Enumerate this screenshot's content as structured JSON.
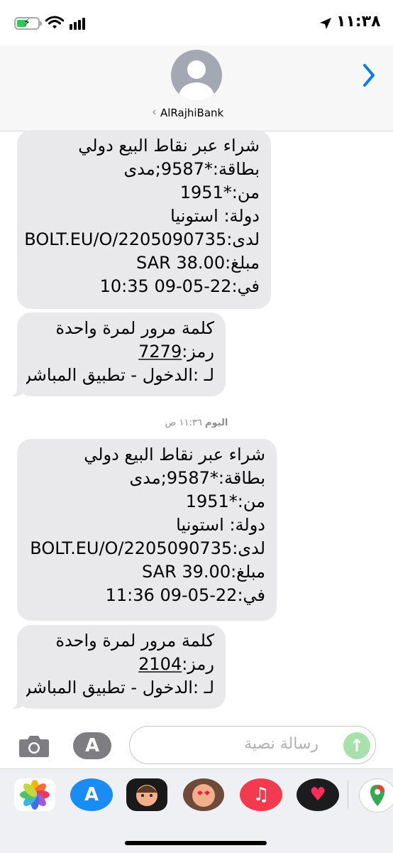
{
  "status_bar": {
    "time": "١١:٣٨"
  },
  "header": {
    "contact_name": "AlRajhiBank"
  },
  "messages": [
    {
      "lines": [
        "شراء عبر نقاط البيع دولي",
        "بطاقة:*9587;مدى",
        "من:*1951",
        "دولة: استونيا",
        "لدى:BOLT.EU/O/2205090735",
        "مبلغ:SAR 38.00",
        "في:22-05-09 10:35"
      ]
    },
    {
      "lines": [
        "كلمة مرور لمرة واحدة",
        "رمز:",
        "لـ :الدخول - تطبيق المباشر"
      ],
      "code": "7279"
    },
    {
      "lines": [
        "شراء عبر نقاط البيع دولي",
        "بطاقة:*9587;مدى",
        "من:*1951",
        "دولة: استونيا",
        "لدى:BOLT.EU/O/2205090735",
        "مبلغ:SAR 39.00",
        "في:22-05-09 11:36"
      ]
    },
    {
      "lines": [
        "كلمة مرور لمرة واحدة",
        "رمز:",
        "لـ :الدخول - تطبيق المباشر"
      ],
      "code": "2104"
    }
  ],
  "timestamp": {
    "day": "اليوم",
    "time": "١١:٣٦ ص"
  },
  "input": {
    "placeholder": "رسالة نصية"
  },
  "drawer": {
    "apps": [
      "photos-icon",
      "app-store-icon",
      "memoji-icon",
      "memoji-stickers-icon",
      "music-icon",
      "digital-touch-icon",
      "google-maps-icon"
    ]
  },
  "colors": {
    "bubble": "#e9e9eb",
    "accent": "#007aff",
    "send": "#a8e0ae"
  }
}
